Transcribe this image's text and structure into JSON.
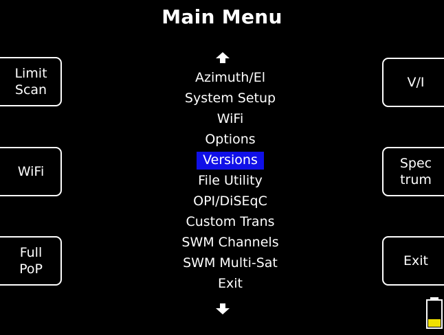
{
  "screen": {
    "title": "Main Menu",
    "accent_color": "#1010e8",
    "background_color": "#000000"
  },
  "softkeys": {
    "left": [
      {
        "label": "Limit\nScan"
      },
      {
        "label": "WiFi"
      },
      {
        "label": "Full\nPoP"
      }
    ],
    "right": [
      {
        "label": "V/I"
      },
      {
        "label": "Spec\ntrum"
      },
      {
        "label": "Exit"
      }
    ]
  },
  "menu": {
    "scroll_up_icon": "arrow-up",
    "scroll_down_icon": "arrow-down",
    "selected_item": "Versions",
    "items": [
      {
        "label": "Azimuth/El"
      },
      {
        "label": "System Setup"
      },
      {
        "label": "WiFi"
      },
      {
        "label": "Options"
      },
      {
        "label": "Versions"
      },
      {
        "label": "File Utility"
      },
      {
        "label": "OPI/DiSEqC"
      },
      {
        "label": "Custom Trans"
      },
      {
        "label": "SWM Channels"
      },
      {
        "label": "SWM Multi-Sat"
      },
      {
        "label": "Exit"
      }
    ]
  },
  "battery": {
    "icon": "battery-icon",
    "level": 0.3,
    "fill_color": "#f0e000"
  }
}
